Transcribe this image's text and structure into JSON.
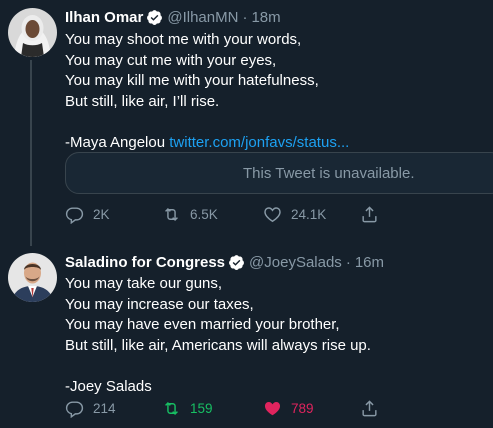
{
  "tweets": [
    {
      "name": "Ilhan Omar",
      "handle": "@IlhanMN",
      "separator": "·",
      "time": "18m",
      "lines": [
        "You may shoot me with your words,",
        "You may cut me with your eyes,",
        "You may kill me with your hatefulness,",
        "But still, like air, I’ll rise.",
        "",
        "-Maya Angelou"
      ],
      "link": "twitter.com/jonfavs/status...",
      "quote": "This Tweet is unavailable.",
      "replies": "2K",
      "retweets": "6.5K",
      "likes": "24.1K"
    },
    {
      "name": "Saladino for Congress",
      "handle": "@JoeySalads",
      "separator": "·",
      "time": "16m",
      "lines": [
        "You may take our guns,",
        "You may increase our taxes,",
        "You may have even married your brother,",
        "But still, like air, Americans will always rise up.",
        "",
        "-Joey Salads"
      ],
      "replies": "214",
      "retweets": "159",
      "likes": "789"
    }
  ],
  "colors": {
    "background": "#15202b",
    "accent": "#1da1f2",
    "muted": "#8899a6",
    "retweet_active": "#17bf63",
    "like_active": "#e0245e"
  },
  "icons": [
    "reply-icon",
    "retweet-icon",
    "like-icon",
    "share-icon",
    "verified-badge-icon"
  ]
}
